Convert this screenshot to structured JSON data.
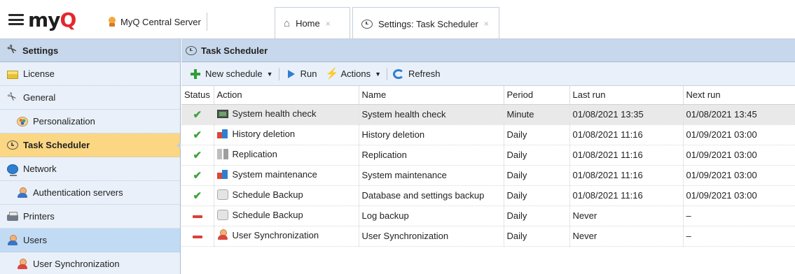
{
  "topbar": {
    "logo_main": "my",
    "logo_q": "Q",
    "server_name": "MyQ Central Server"
  },
  "tabs": [
    {
      "label": "Home",
      "close": "×"
    },
    {
      "label": "Settings: Task Scheduler",
      "close": "×"
    }
  ],
  "sidebar": {
    "header": "Settings",
    "items": [
      {
        "label": "License",
        "icon": "license-icon"
      },
      {
        "label": "General",
        "icon": "tools-icon"
      },
      {
        "label": "Personalization",
        "icon": "palette-icon"
      },
      {
        "label": "Task Scheduler",
        "icon": "clock-icon"
      },
      {
        "label": "Network",
        "icon": "globe-icon"
      },
      {
        "label": "Authentication servers",
        "icon": "user-icon"
      },
      {
        "label": "Printers",
        "icon": "printer-icon"
      },
      {
        "label": "Users",
        "icon": "user-icon"
      },
      {
        "label": "User Synchronization",
        "icon": "user-sync-icon"
      }
    ]
  },
  "main": {
    "title": "Task Scheduler",
    "toolbar": {
      "new_schedule": "New schedule",
      "run": "Run",
      "actions": "Actions",
      "refresh": "Refresh"
    },
    "columns": [
      "Status",
      "Action",
      "Name",
      "Period",
      "Last run",
      "Next run"
    ],
    "rows": [
      {
        "status": "enabled",
        "action": "System health check",
        "action_icon": "monitor-icon",
        "name": "System health check",
        "period": "Minute",
        "last_run": "01/08/2021 13:35",
        "next_run": "01/08/2021 13:45"
      },
      {
        "status": "enabled",
        "action": "History deletion",
        "action_icon": "blocks-icon",
        "name": "History deletion",
        "period": "Daily",
        "last_run": "01/08/2021 11:16",
        "next_run": "01/09/2021 03:00"
      },
      {
        "status": "enabled",
        "action": "Replication",
        "action_icon": "replication-icon",
        "name": "Replication",
        "period": "Daily",
        "last_run": "01/08/2021 11:16",
        "next_run": "01/09/2021 03:00"
      },
      {
        "status": "enabled",
        "action": "System maintenance",
        "action_icon": "blocks-icon",
        "name": "System maintenance",
        "period": "Daily",
        "last_run": "01/08/2021 11:16",
        "next_run": "01/09/2021 03:00"
      },
      {
        "status": "enabled",
        "action": "Schedule Backup",
        "action_icon": "database-icon",
        "name": "Database and settings backup",
        "period": "Daily",
        "last_run": "01/08/2021 11:16",
        "next_run": "01/09/2021 03:00"
      },
      {
        "status": "disabled",
        "action": "Schedule Backup",
        "action_icon": "database-icon",
        "name": "Log backup",
        "period": "Daily",
        "last_run": "Never",
        "next_run": "–"
      },
      {
        "status": "disabled",
        "action": "User Synchronization",
        "action_icon": "user-sync-icon",
        "name": "User Synchronization",
        "period": "Daily",
        "last_run": "Never",
        "next_run": "–"
      }
    ]
  },
  "colors": {
    "accent_header": "#c7d8ec",
    "sidebar_bg": "#e9f0f9",
    "active_item": "#fbd683",
    "selected_item": "#c2dbf4",
    "enabled": "#3ea33e",
    "disabled": "#d8403a",
    "logo_q": "#e3262f"
  }
}
